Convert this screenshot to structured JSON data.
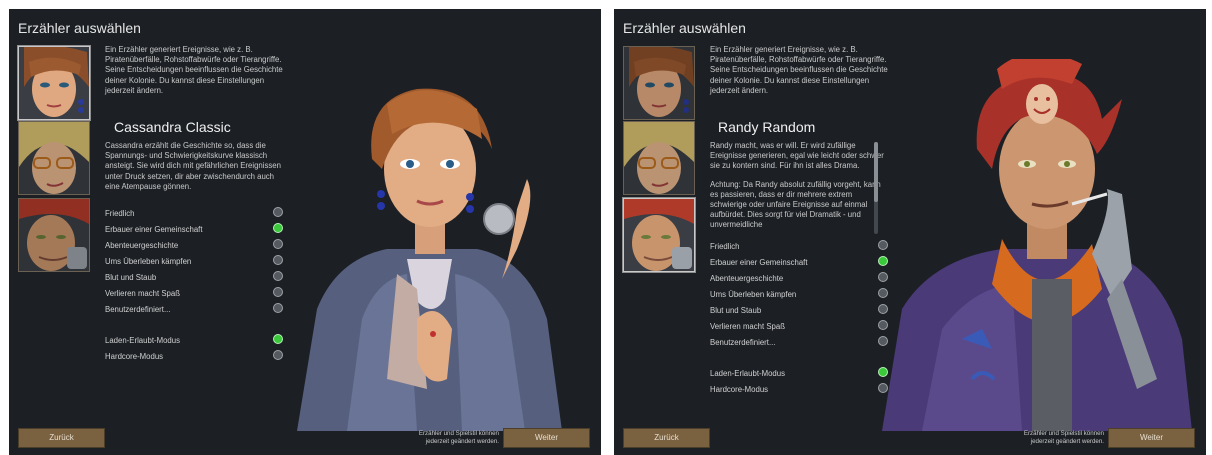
{
  "panels": [
    {
      "title": "Erzähler auswählen",
      "intro": "Ein Erzähler generiert Ereignisse, wie z. B. Piratenüberfälle, Rohstoffabwürfe oder Tierangriffe. Seine Entscheidungen beeinflussen die Geschichte deiner Kolonie. Du kannst diese Einstellungen jederzeit ändern.",
      "selected_portrait": 1,
      "storyteller_name": "Cassandra Classic",
      "storyteller_desc": [
        "Cassandra erzählt die Geschichte so, dass die Spannungs- und Schwierigkeitskurve klassisch ansteigt. Sie wird dich mit gefährlichen Ereignissen unter Druck setzen, dir aber zwischendurch auch eine Atempause gönnen."
      ],
      "difficulties": [
        {
          "label": "Friedlich",
          "on": false
        },
        {
          "label": "Erbauer einer Gemeinschaft",
          "on": true
        },
        {
          "label": "Abenteuergeschichte",
          "on": false
        },
        {
          "label": "Ums Überleben kämpfen",
          "on": false
        },
        {
          "label": "Blut und Staub",
          "on": false
        },
        {
          "label": "Verlieren macht Spaß",
          "on": false
        },
        {
          "label": "Benutzerdefiniert...",
          "on": false
        }
      ],
      "modes": [
        {
          "label": "Laden-Erlaubt-Modus",
          "on": true
        },
        {
          "label": "Hardcore-Modus",
          "on": false
        }
      ],
      "back_label": "Zurück",
      "next_label": "Weiter",
      "note": "Erzähler und Spielstil können jederzeit geändert werden."
    },
    {
      "title": "Erzähler auswählen",
      "intro": "Ein Erzähler generiert Ereignisse, wie z. B. Piratenüberfälle, Rohstoffabwürfe oder Tierangriffe. Seine Entscheidungen beeinflussen die Geschichte deiner Kolonie. Du kannst diese Einstellungen jederzeit ändern.",
      "selected_portrait": 3,
      "storyteller_name": "Randy Random",
      "storyteller_desc": [
        "Randy macht, was er will. Er wird zufällige Ereignisse generieren, egal wie leicht oder schwer sie zu kontern sind. Für ihn ist alles Drama.",
        "Achtung: Da Randy absolut zufällig vorgeht, kann es passieren, dass er dir mehrere extrem schwierige oder unfaire Ereignisse auf einmal aufbürdet. Dies sorgt für viel Dramatik - und unvermeidliche"
      ],
      "difficulties": [
        {
          "label": "Friedlich",
          "on": false
        },
        {
          "label": "Erbauer einer Gemeinschaft",
          "on": true
        },
        {
          "label": "Abenteuergeschichte",
          "on": false
        },
        {
          "label": "Ums Überleben kämpfen",
          "on": false
        },
        {
          "label": "Blut und Staub",
          "on": false
        },
        {
          "label": "Verlieren macht Spaß",
          "on": false
        },
        {
          "label": "Benutzerdefiniert...",
          "on": false
        }
      ],
      "modes": [
        {
          "label": "Laden-Erlaubt-Modus",
          "on": true
        },
        {
          "label": "Hardcore-Modus",
          "on": false
        }
      ],
      "back_label": "Zurück",
      "next_label": "Weiter",
      "note": "Erzähler und Spielstil können jederzeit geändert werden."
    }
  ],
  "colors": {
    "panel_bg": "#1c2025",
    "button_brown": "#7a6140",
    "radio_on": "#39c93a",
    "radio_off": "#555a60"
  },
  "icons": {
    "portrait_1": "cassandra-portrait",
    "portrait_2": "phoebe-portrait",
    "portrait_3": "randy-portrait"
  }
}
